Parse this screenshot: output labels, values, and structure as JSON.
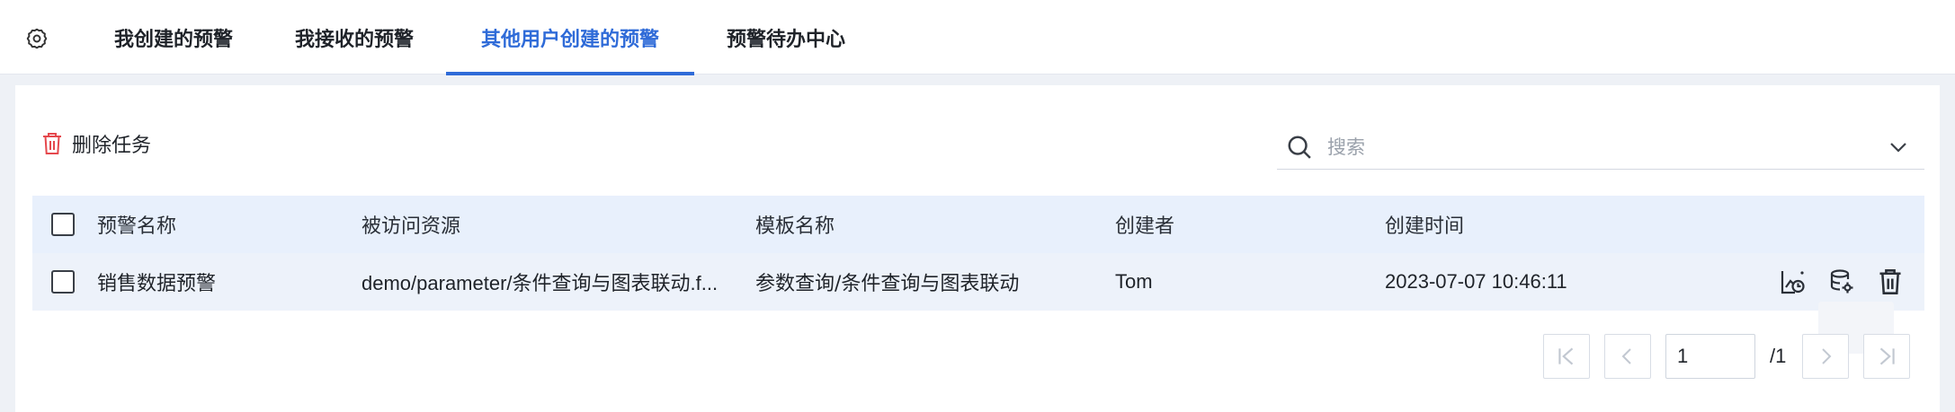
{
  "tabs": [
    {
      "label": "我创建的预警",
      "active": false
    },
    {
      "label": "我接收的预警",
      "active": false
    },
    {
      "label": "其他用户创建的预警",
      "active": true
    },
    {
      "label": "预警待办中心",
      "active": false
    }
  ],
  "toolbar": {
    "delete_label": "删除任务",
    "search_placeholder": "搜索"
  },
  "table": {
    "headers": [
      "预警名称",
      "被访问资源",
      "模板名称",
      "创建者",
      "创建时间"
    ],
    "rows": [
      {
        "name": "销售数据预警",
        "resource": "demo/parameter/条件查询与图表联动.f...",
        "template": "参数查询/条件查询与图表联动",
        "creator": "Tom",
        "created": "2023-07-07 10:46:11"
      }
    ]
  },
  "pagination": {
    "current_page": "1",
    "total": "/1"
  },
  "colors": {
    "accent": "#2f6bd8",
    "danger": "#e5484d",
    "header_bg": "#e8f0fc",
    "row_bg": "#edf2fa"
  },
  "icons": {
    "settings": "gear-icon",
    "delete": "trash-icon",
    "search": "search-icon",
    "expand": "chevron-down-icon",
    "row_actions": [
      "chart-timer-icon",
      "database-gear-icon",
      "trash-icon"
    ]
  }
}
